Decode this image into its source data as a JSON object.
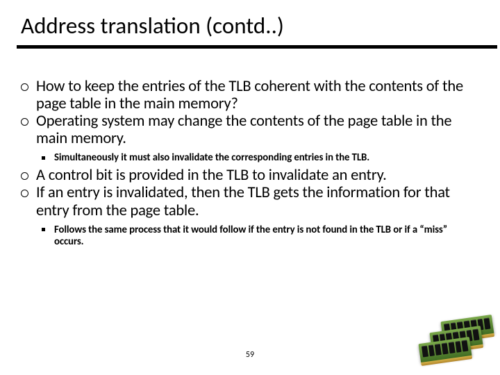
{
  "title": "Address translation (contd..)",
  "bullets": {
    "b1": "How to keep the entries of the TLB coherent with the contents of the page table in the main memory?",
    "b2": "Operating system may change the contents of the page table in the main memory.",
    "b2_sub": "Simultaneously it must also invalidate the corresponding entries in the TLB.",
    "b3": "A control bit is provided in the TLB to invalidate an entry.",
    "b4": "If an entry is invalidated, then the TLB gets the information for that entry from the page table.",
    "b4_sub": "Follows the same process that it would follow if the entry is not found in the TLB or if a “miss” occurs."
  },
  "page_number": "59"
}
